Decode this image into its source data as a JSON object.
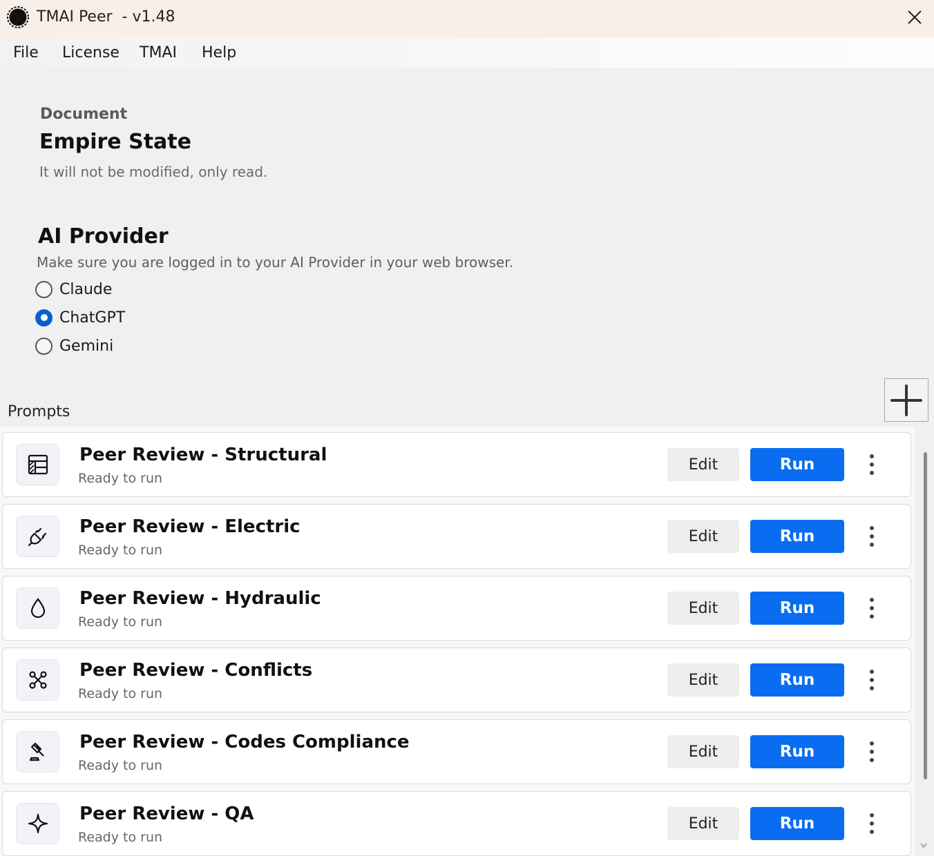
{
  "window": {
    "title": "TMAI Peer  - v1.48",
    "app_icon": "app-logo-icon",
    "close_icon": "close-icon"
  },
  "menu": {
    "items": [
      {
        "label": "File"
      },
      {
        "label": "License"
      },
      {
        "label": "TMAI"
      },
      {
        "label": "Help"
      }
    ]
  },
  "document": {
    "label": "Document",
    "name": "Empire State",
    "note": "It will not be modified, only read."
  },
  "provider": {
    "title": "AI Provider",
    "note": "Make sure you are logged in to your AI Provider in your web browser.",
    "options": [
      {
        "label": "Claude",
        "selected": false
      },
      {
        "label": "ChatGPT",
        "selected": true
      },
      {
        "label": "Gemini",
        "selected": false
      }
    ],
    "selected": "ChatGPT",
    "accent_color": "#0a5fd0"
  },
  "prompts": {
    "label": "Prompts",
    "add_icon": "plus-icon",
    "edit_label": "Edit",
    "run_label": "Run",
    "run_color": "#0a6cf0",
    "items": [
      {
        "title": "Peer Review - Structural",
        "status": "Ready to run",
        "icon": "structural-grid-icon"
      },
      {
        "title": "Peer Review - Electric",
        "status": "Ready to run",
        "icon": "plug-icon"
      },
      {
        "title": "Peer Review - Hydraulic",
        "status": "Ready to run",
        "icon": "water-drop-icon"
      },
      {
        "title": "Peer Review - Conflicts",
        "status": "Ready to run",
        "icon": "network-nodes-icon"
      },
      {
        "title": "Peer Review - Codes Compliance",
        "status": "Ready to run",
        "icon": "gavel-icon"
      },
      {
        "title": "Peer Review - QA",
        "status": "Ready to run",
        "icon": "sparkle-icon"
      }
    ]
  }
}
